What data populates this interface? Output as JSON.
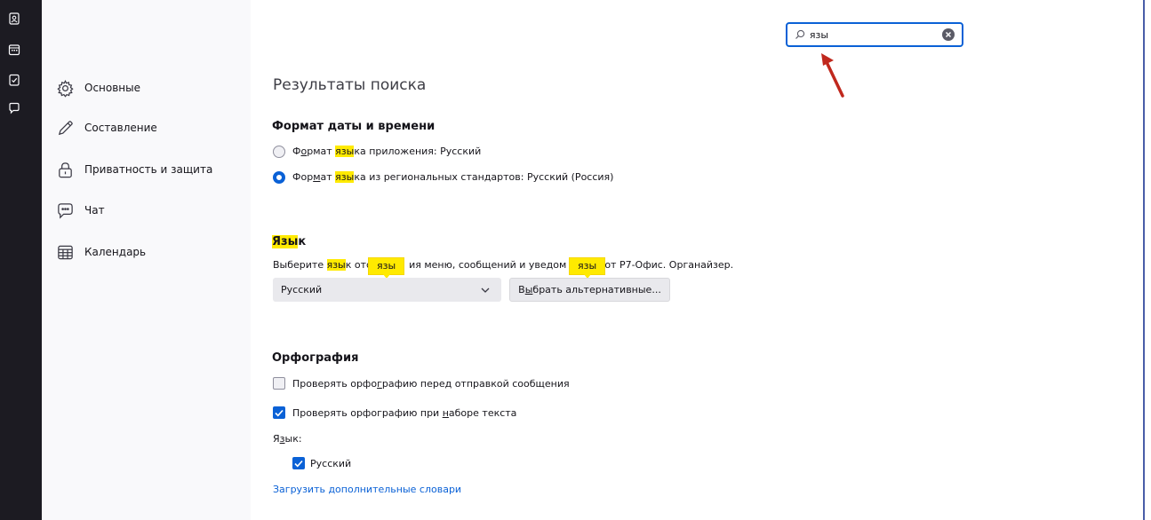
{
  "rail": {
    "icons": [
      "address-book-icon",
      "calendar-icon",
      "tasks-icon",
      "chat-icon"
    ]
  },
  "categories": [
    {
      "label": "Основные",
      "icon": "gear-icon"
    },
    {
      "label": "Составление",
      "icon": "pencil-icon"
    },
    {
      "label": "Приватность и защита",
      "icon": "lock-icon"
    },
    {
      "label": "Чат",
      "icon": "chat-icon"
    },
    {
      "label": "Календарь",
      "icon": "calendar-icon"
    }
  ],
  "search": {
    "value": "язы"
  },
  "results_title": "Результаты поиска",
  "datetime": {
    "heading": "Формат даты и времени",
    "opt1": {
      "pre": "Ф",
      "u": "о",
      "mid": "рмат ",
      "hl": "язы",
      "post": "ка приложения: Русский",
      "checked": false
    },
    "opt2": {
      "pre": "Фор",
      "u": "м",
      "mid": "ат ",
      "hl": "язы",
      "post": "ка из региональных стандартов: Русский (Россия)",
      "checked": true
    }
  },
  "language": {
    "heading_hl": "Язы",
    "heading_post": "к",
    "desc_pre": "Выберите ",
    "desc_hl": "язы",
    "desc_a": "к отс",
    "desc_b": "ия меню, сообщений и уведом",
    "desc_c": "от Р7-Офис. Органайзер.",
    "tooltip": "язы",
    "select_value": "Русский",
    "alt_button": {
      "pre": "В",
      "u": "ы",
      "post": "брать альтернативные..."
    }
  },
  "spelling": {
    "heading": "Орфография",
    "check1": {
      "pre": "Проверять орфо",
      "u": "г",
      "post": "рафию перед отправкой сообщения",
      "checked": false
    },
    "check2": {
      "pre": "Проверять орфографию при ",
      "u": "н",
      "post": "аборе текста",
      "checked": true
    },
    "lang_label": {
      "pre": "Я",
      "u": "з",
      "post": "ык:"
    },
    "lang_item": {
      "label": "Русский",
      "checked": true
    },
    "download_link": "Загрузить дополнительные словари"
  },
  "colors": {
    "accent": "#0a61d6",
    "highlight": "#ffea00",
    "arrow": "#c0281d"
  }
}
